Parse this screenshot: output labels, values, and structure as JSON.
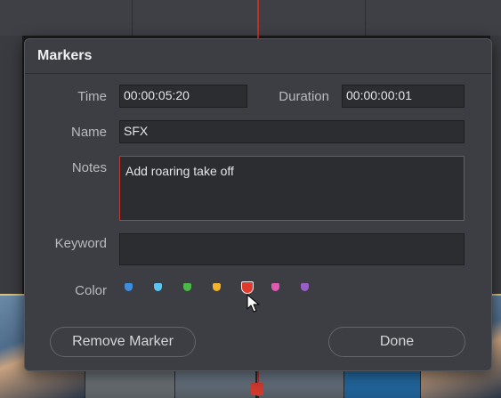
{
  "dialog": {
    "title": "Markers",
    "time_label": "Time",
    "time_value": "00:00:05:20",
    "duration_label": "Duration",
    "duration_value": "00:00:00:01",
    "name_label": "Name",
    "name_value": "SFX",
    "notes_label": "Notes",
    "notes_value": "Add roaring take off",
    "keyword_label": "Keyword",
    "keyword_value": "",
    "color_label": "Color",
    "colors": [
      {
        "name": "blue",
        "hex": "#3f8de0"
      },
      {
        "name": "cyan",
        "hex": "#58c6f0"
      },
      {
        "name": "green",
        "hex": "#4cb947"
      },
      {
        "name": "yellow",
        "hex": "#f1b32b"
      },
      {
        "name": "red",
        "hex": "#e03a2f",
        "selected": true
      },
      {
        "name": "pink",
        "hex": "#df5bb3"
      },
      {
        "name": "purple",
        "hex": "#9a5fc6"
      }
    ],
    "remove_button_label": "Remove Marker",
    "done_button_label": "Done"
  },
  "accent_color": "#c23b33"
}
